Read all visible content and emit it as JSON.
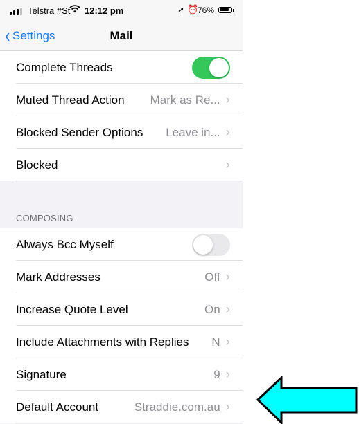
{
  "status_bar": {
    "carrier": "Telstra #St",
    "time": "12:12 pm",
    "battery": "76%"
  },
  "nav": {
    "back_label": "Settings",
    "title": "Mail"
  },
  "threading": [
    {
      "label": "Complete Threads",
      "type": "toggle",
      "state": "on"
    },
    {
      "label": "Muted Thread Action",
      "value": "Mark as Re..."
    },
    {
      "label": "Blocked Sender Options",
      "value": "Leave in..."
    },
    {
      "label": "Blocked",
      "value": ""
    }
  ],
  "composing": {
    "header": "COMPOSING",
    "rows": [
      {
        "label": "Always Bcc Myself",
        "type": "toggle",
        "state": "off"
      },
      {
        "label": "Mark Addresses",
        "value": "Off"
      },
      {
        "label": "Increase Quote Level",
        "value": "On"
      },
      {
        "label": "Include Attachments with Replies",
        "value": "N"
      },
      {
        "label": "Signature",
        "value": "9"
      },
      {
        "label": "Default Account",
        "value": "Straddie.com.au"
      }
    ]
  },
  "chevron": "›",
  "colors": {
    "accent": "#1b7cf6",
    "toggle_on": "#34c759",
    "arrow_fill": "#00ffff"
  },
  "icons": [
    "signal-icon",
    "wifi-icon",
    "location-icon",
    "alarm-icon",
    "battery-icon",
    "back-chevron-icon",
    "chevron-right-icon",
    "pointer-arrow"
  ]
}
